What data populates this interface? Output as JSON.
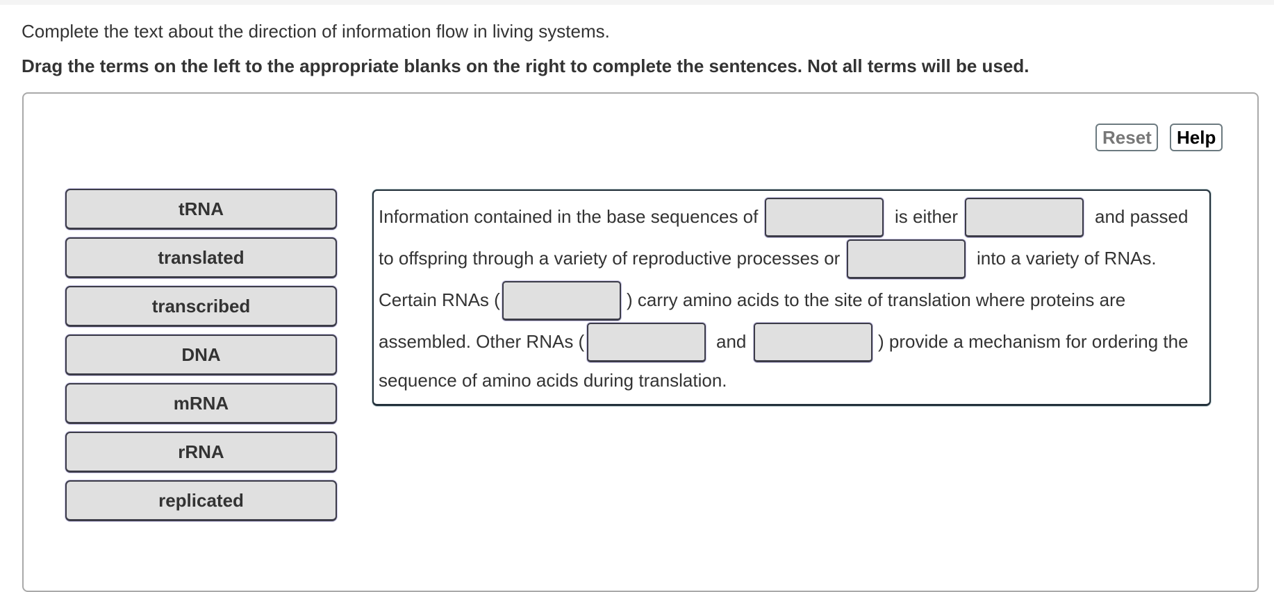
{
  "header": {
    "intro": "Complete the text about the direction of information flow in living systems.",
    "instruction": "Drag the terms on the left to the appropriate blanks on the right to complete the sentences. Not all terms will be used."
  },
  "toolbar": {
    "reset_label": "Reset",
    "help_label": "Help"
  },
  "terms": [
    {
      "label": "tRNA"
    },
    {
      "label": "translated"
    },
    {
      "label": "transcribed"
    },
    {
      "label": "DNA"
    },
    {
      "label": "mRNA"
    },
    {
      "label": "rRNA"
    },
    {
      "label": "replicated"
    }
  ],
  "passage": {
    "line1": {
      "a": "Information contained in the base sequences of",
      "b": "is either",
      "c": "and passed"
    },
    "line2": {
      "a": "to offspring through a variety of reproductive processes or",
      "b": "into a variety of RNAs."
    },
    "line3": {
      "a": "Certain RNAs (",
      "b": ") carry amino acids to the site of translation where proteins are"
    },
    "line4": {
      "a": "assembled. Other RNAs (",
      "b": "and",
      "c": ") provide a mechanism for ordering the"
    },
    "line5": {
      "a": "sequence of amino acids during translation."
    },
    "blanks": [
      "",
      "",
      "",
      "",
      "",
      ""
    ]
  }
}
